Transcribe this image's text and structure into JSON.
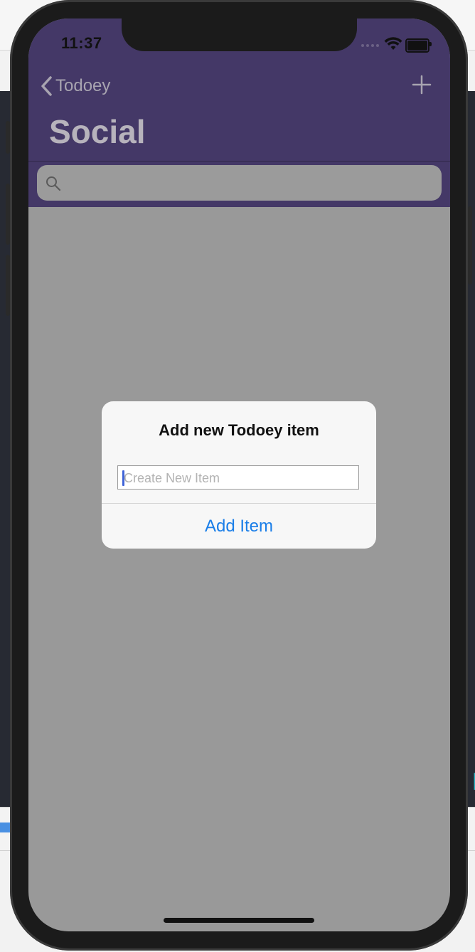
{
  "status_bar": {
    "time": "11:37"
  },
  "nav": {
    "back_label": "Todoey",
    "title": "Social",
    "add_icon": "plus-icon"
  },
  "search": {
    "icon": "search-icon",
    "placeholder": ""
  },
  "alert": {
    "title": "Add new Todoey item",
    "input_placeholder": "Create New Item",
    "action_label": "Add Item"
  },
  "colors": {
    "navbar": "#443867",
    "content_dim": "#999999",
    "action_blue": "#1a7ee8"
  }
}
